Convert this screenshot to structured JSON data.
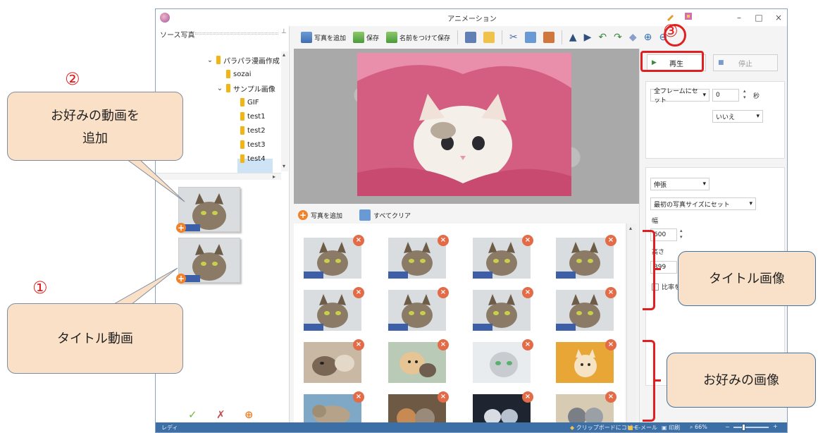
{
  "window": {
    "title": "アニメーション",
    "min": "–",
    "max": "□",
    "close": "×"
  },
  "source_panel": {
    "title": "ソース写真",
    "tree": [
      {
        "label": "パラパラ漫画作成"
      },
      {
        "label": "sozai"
      },
      {
        "label": "サンプル画像"
      },
      {
        "label": "GIF"
      },
      {
        "label": "test1"
      },
      {
        "label": "test2"
      },
      {
        "label": "test3"
      },
      {
        "label": "test4"
      }
    ]
  },
  "toolbar": {
    "add_photo": "写真を追加",
    "save": "保存",
    "save_as": "名前をつけて保存"
  },
  "grid_toolbar": {
    "add_photo": "写真を追加",
    "clear_all": "すべてクリア"
  },
  "right_panel": {
    "play": "再生",
    "stop": "停止",
    "frame_select": "全フレームにセット",
    "seconds_value": "0",
    "seconds_unit": "秒",
    "loop_select": "いいえ",
    "stretch_select": "伸張",
    "size_select": "最初の写真サイズにセット",
    "width_label": "幅",
    "width_value": "600",
    "height_label": "高さ",
    "height_value": "399",
    "ratio_label": "比率を"
  },
  "statusbar": {
    "ready": "レディ",
    "copy": "クリップボードにコピー",
    "email": "E-メール",
    "print": "印刷",
    "zoom": "66%",
    "zoom_level": 0.66
  },
  "annotations": {
    "callout_add_video": [
      "お好みの動画を",
      "追加"
    ],
    "callout_title_video": "タイトル動画",
    "callout_title_image": "タイトル画像",
    "callout_fav_image": "お好みの画像",
    "num1": "①",
    "num2": "②",
    "num3": "③"
  },
  "colors": {
    "annotation_red": "#e02020",
    "callout_fill": "#fbe0c8",
    "status_blue": "#3c6fa5",
    "badge_orange": "#f0822c"
  }
}
